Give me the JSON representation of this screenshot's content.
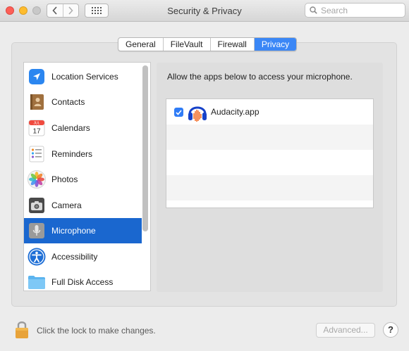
{
  "window": {
    "title": "Security & Privacy"
  },
  "search": {
    "placeholder": "Search"
  },
  "tabs": [
    {
      "label": "General",
      "active": false
    },
    {
      "label": "FileVault",
      "active": false
    },
    {
      "label": "Firewall",
      "active": false
    },
    {
      "label": "Privacy",
      "active": true
    }
  ],
  "sidebar": {
    "items": [
      {
        "label": "Location Services",
        "icon": "location-arrow-icon",
        "selected": false
      },
      {
        "label": "Contacts",
        "icon": "contacts-book-icon",
        "selected": false
      },
      {
        "label": "Calendars",
        "icon": "calendar-icon",
        "selected": false
      },
      {
        "label": "Reminders",
        "icon": "reminders-list-icon",
        "selected": false
      },
      {
        "label": "Photos",
        "icon": "photos-flower-icon",
        "selected": false
      },
      {
        "label": "Camera",
        "icon": "camera-icon",
        "selected": false
      },
      {
        "label": "Microphone",
        "icon": "microphone-icon",
        "selected": true
      },
      {
        "label": "Accessibility",
        "icon": "accessibility-person-icon",
        "selected": false
      },
      {
        "label": "Full Disk Access",
        "icon": "folder-icon",
        "selected": false
      }
    ],
    "calendar_icon": {
      "month": "JUL",
      "day": "17"
    }
  },
  "main": {
    "prompt": "Allow the apps below to access your microphone.",
    "apps": [
      {
        "name": "Audacity.app",
        "checked": true,
        "icon": "audacity-headphones-icon"
      }
    ]
  },
  "footer": {
    "lock_text": "Click the lock to make changes.",
    "advanced_label": "Advanced...",
    "help_label": "?"
  },
  "colors": {
    "accent": "#3b87f6",
    "selection": "#1a67cf",
    "close": "#fd5f57",
    "minimize": "#febc2e"
  }
}
